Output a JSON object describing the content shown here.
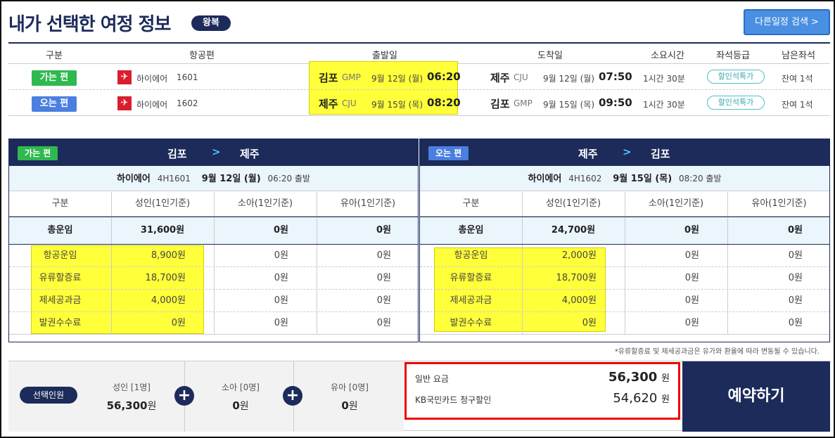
{
  "header": {
    "title": "내가 선택한 여정 정보",
    "badge": "왕복",
    "search_button": "다른일정 검색 >"
  },
  "summary": {
    "columns": [
      "구분",
      "항공편",
      "출발일",
      "도착일",
      "소요시간",
      "좌석등급",
      "남은좌석"
    ],
    "rows": [
      {
        "leg": "가는 편",
        "airline": "하이에어",
        "flight": "1601",
        "dep_city": "김포",
        "dep_code": "GMP",
        "dep_date": "9월 12일 (월)",
        "dep_time": "06:20",
        "arr_city": "제주",
        "arr_code": "CJU",
        "arr_date": "9월 12일 (월)",
        "arr_time": "07:50",
        "duration": "1시간 30분",
        "fare_class": "할인석특가",
        "seats": "잔여 1석"
      },
      {
        "leg": "오는 편",
        "airline": "하이에어",
        "flight": "1602",
        "dep_city": "제주",
        "dep_code": "CJU",
        "dep_date": "9월 15일 (목)",
        "dep_time": "08:20",
        "arr_city": "김포",
        "arr_code": "GMP",
        "arr_date": "9월 15일 (목)",
        "arr_time": "09:50",
        "duration": "1시간 30분",
        "fare_class": "할인석특가",
        "seats": "잔여 1석"
      }
    ]
  },
  "fare_columns": [
    "구분",
    "성인(1인기준)",
    "소아(1인기준)",
    "유아(1인기준)"
  ],
  "outbound": {
    "tag": "가는 편",
    "from": "김포",
    "arrow": ">",
    "to": "제주",
    "airline": "하이에어",
    "flight": "4H1601",
    "date": "9월 12일 (월)",
    "time": "06:20 출발",
    "total": {
      "label": "총운임",
      "adult": "31,600원",
      "child": "0원",
      "infant": "0원"
    },
    "items": [
      {
        "label": "항공운임",
        "adult": "8,900원",
        "child": "0원",
        "infant": "0원"
      },
      {
        "label": "유류할증료",
        "adult": "18,700원",
        "child": "0원",
        "infant": "0원"
      },
      {
        "label": "제세공과금",
        "adult": "4,000원",
        "child": "0원",
        "infant": "0원"
      },
      {
        "label": "발권수수료",
        "adult": "0원",
        "child": "0원",
        "infant": "0원"
      }
    ]
  },
  "inbound": {
    "tag": "오는 편",
    "from": "제주",
    "arrow": ">",
    "to": "김포",
    "airline": "하이에어",
    "flight": "4H1602",
    "date": "9월 15일 (목)",
    "time": "08:20 출발",
    "total": {
      "label": "총운임",
      "adult": "24,700원",
      "child": "0원",
      "infant": "0원"
    },
    "items": [
      {
        "label": "항공운임",
        "adult": "2,000원",
        "child": "0원",
        "infant": "0원"
      },
      {
        "label": "유류할증료",
        "adult": "18,700원",
        "child": "0원",
        "infant": "0원"
      },
      {
        "label": "제세공과금",
        "adult": "4,000원",
        "child": "0원",
        "infant": "0원"
      },
      {
        "label": "발권수수료",
        "adult": "0원",
        "child": "0원",
        "infant": "0원"
      }
    ]
  },
  "note": "*유류할증료 및 제세공과금은 유가와 환율에 따라 변동될 수 있습니다.",
  "passengers": {
    "label": "선택인원",
    "adult": {
      "label": "성인 [1명]",
      "amount": "56,300",
      "unit": "원"
    },
    "child": {
      "label": "소아 [0명]",
      "amount": "0",
      "unit": "원"
    },
    "infant": {
      "label": "유아 [0명]",
      "amount": "0",
      "unit": "원"
    }
  },
  "price": {
    "regular_label": "일반 요금",
    "regular_value": "56,300",
    "regular_unit": "원",
    "discount_label": "KB국민카드 청구할인",
    "discount_value": "54,620",
    "discount_unit": "원"
  },
  "reserve_button": "예약하기",
  "colors": {
    "navy": "#1c2b5a",
    "green": "#2fb94e",
    "blue": "#4a7fe0",
    "highlight": "#ffff3a",
    "alert": "#e00000"
  }
}
